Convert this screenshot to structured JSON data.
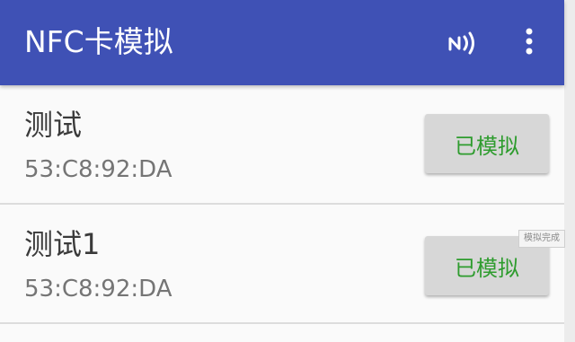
{
  "toolbar": {
    "title": "NFC卡模拟",
    "nfc_icon": "nfc-icon",
    "more_icon": "more-vert-icon",
    "background_color": "#3f51b5"
  },
  "list": {
    "items": [
      {
        "name": "测试",
        "uid": "53:C8:92:DA",
        "button_label": "已模拟"
      },
      {
        "name": "测试1",
        "uid": "53:C8:92:DA",
        "button_label": "已模拟"
      }
    ]
  },
  "toast": {
    "text": "模拟完成"
  },
  "colors": {
    "accent_green": "#2e9c2e"
  }
}
